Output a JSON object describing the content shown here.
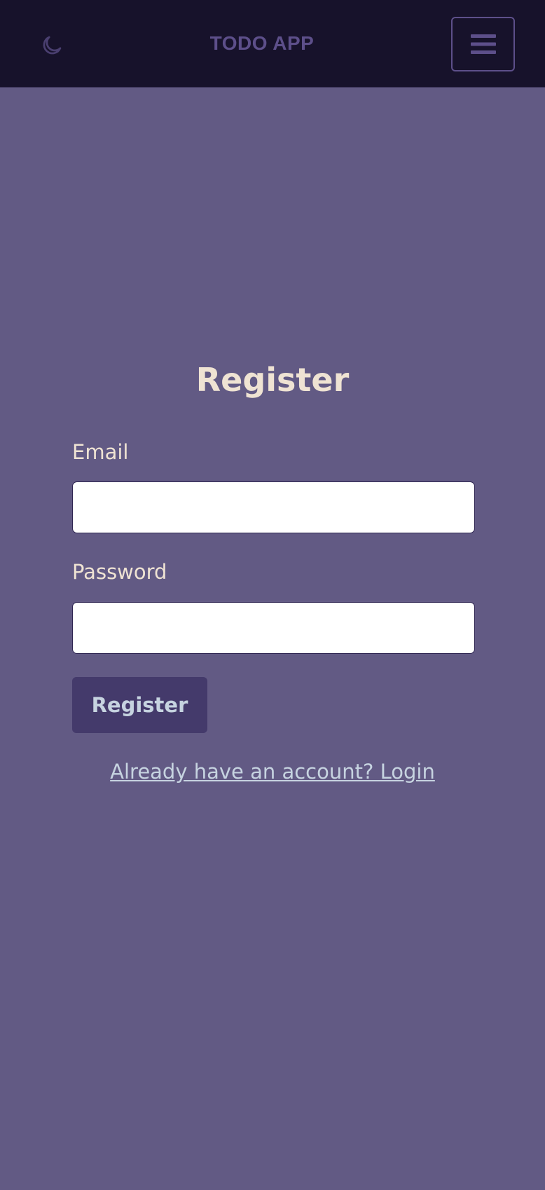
{
  "header": {
    "title": "TODO APP",
    "theme_icon": "moon-icon",
    "menu_icon": "hamburger-menu-icon"
  },
  "form": {
    "title": "Register",
    "email_label": "Email",
    "email_value": "",
    "password_label": "Password",
    "password_value": "",
    "submit_label": "Register",
    "login_link_label": "Already have an account? Login"
  },
  "colors": {
    "header_bg": "#17122b",
    "page_bg": "#625a84",
    "accent_muted": "#5d4f8a",
    "heading_text": "#efe3d3",
    "button_bg": "#443a6b",
    "link_text": "#c6d3e0"
  }
}
